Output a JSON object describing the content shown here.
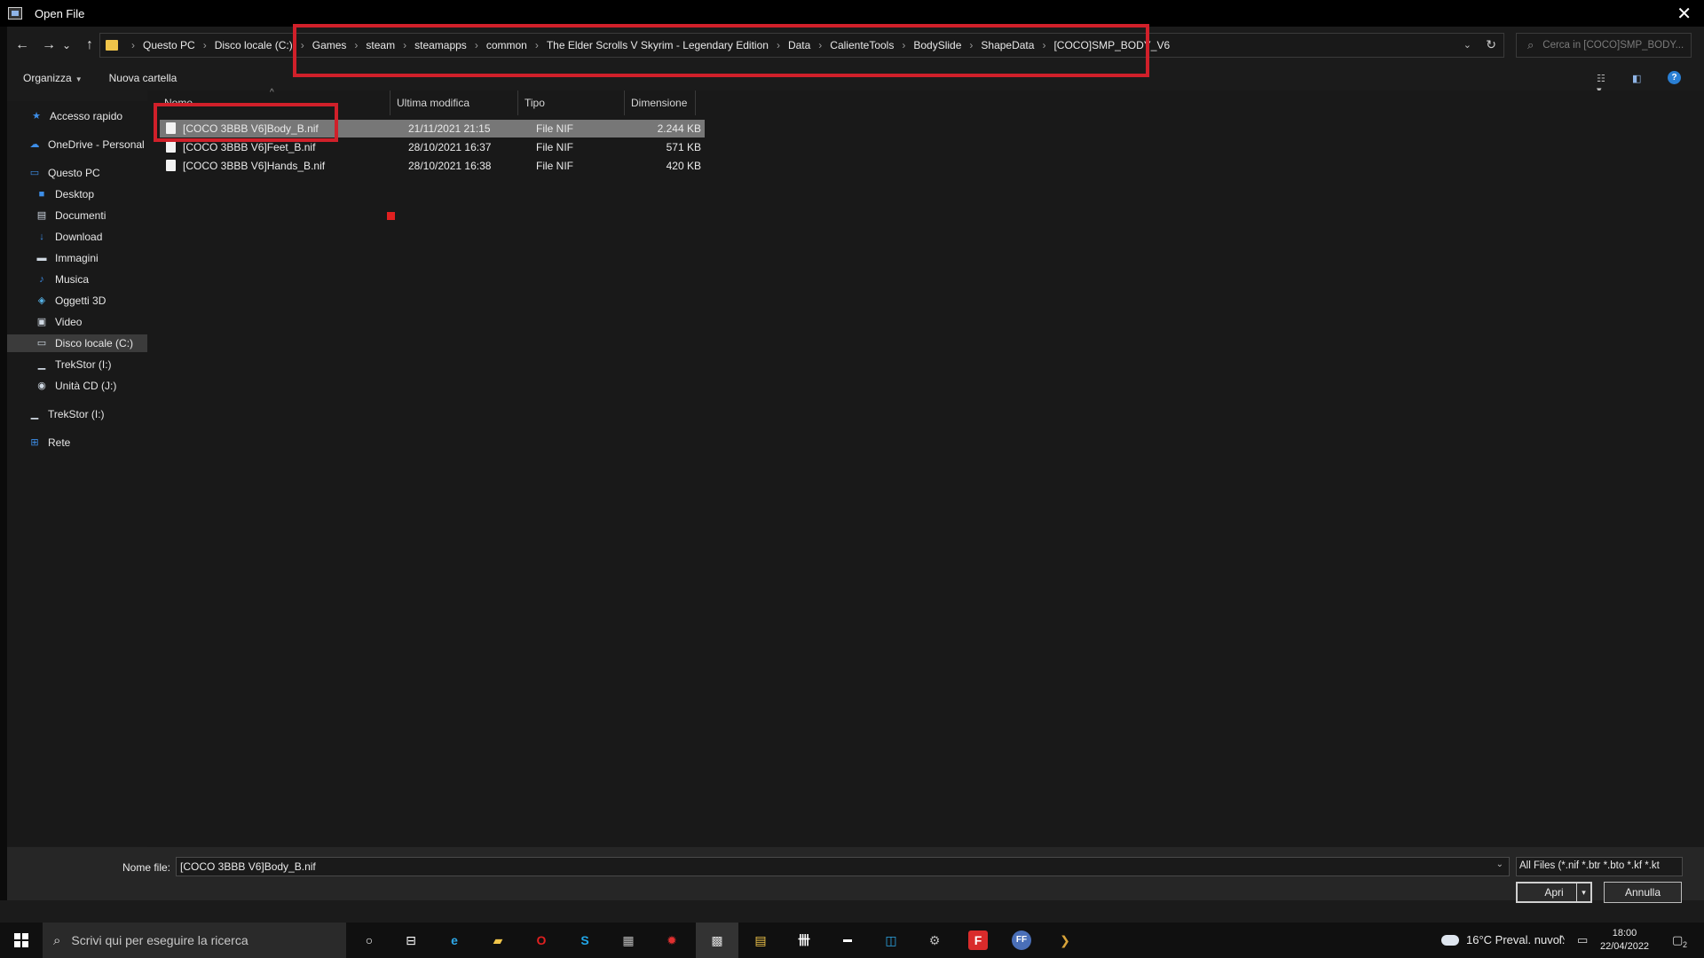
{
  "window": {
    "title": "Open File",
    "close_glyph": "✕"
  },
  "nav_buttons": {
    "back": "←",
    "forward": "→",
    "recent": "⌄",
    "up": "↑"
  },
  "address": {
    "crumbs": [
      "Questo PC",
      "Disco locale (C:)",
      "Games",
      "steam",
      "steamapps",
      "common",
      "The Elder Scrolls V Skyrim - Legendary Edition",
      "Data",
      "CalienteTools",
      "BodySlide",
      "ShapeData",
      "[COCO]SMP_BODY_V6"
    ],
    "separator": "›",
    "dropdown_glyph": "⌄",
    "refresh_glyph": "↻"
  },
  "search": {
    "placeholder": "Cerca in [COCO]SMP_BODY..."
  },
  "toolbar": {
    "organize": "Organizza",
    "new_folder": "Nuova cartella"
  },
  "sidebar": {
    "items": [
      {
        "label": "Accesso rapido",
        "icon": "star-icon"
      },
      {
        "label": "OneDrive - Personal",
        "icon": "cloud-icon"
      },
      {
        "label": "Questo PC",
        "icon": "computer-icon"
      },
      {
        "label": "Desktop",
        "icon": "desktop-icon"
      },
      {
        "label": "Documenti",
        "icon": "documents-icon"
      },
      {
        "label": "Download",
        "icon": "download-icon"
      },
      {
        "label": "Immagini",
        "icon": "images-icon"
      },
      {
        "label": "Musica",
        "icon": "music-icon"
      },
      {
        "label": "Oggetti 3D",
        "icon": "cube-icon"
      },
      {
        "label": "Video",
        "icon": "video-icon"
      },
      {
        "label": "Disco locale (C:)",
        "icon": "drive-icon"
      },
      {
        "label": "TrekStor (I:)",
        "icon": "usb-drive-icon"
      },
      {
        "label": "Unità CD (J:)",
        "icon": "cd-drive-icon"
      },
      {
        "label": "TrekStor (I:)",
        "icon": "usb-drive-icon"
      },
      {
        "label": "Rete",
        "icon": "network-icon"
      }
    ]
  },
  "columns": {
    "name": "Nome",
    "modified": "Ultima modifica",
    "type": "Tipo",
    "size": "Dimensione"
  },
  "files": [
    {
      "name": "[COCO 3BBB V6]Body_B.nif",
      "modified": "21/11/2021 21:15",
      "type": "File NIF",
      "size": "2.244 KB",
      "selected": true
    },
    {
      "name": "[COCO 3BBB V6]Feet_B.nif",
      "modified": "28/10/2021 16:37",
      "type": "File NIF",
      "size": "571 KB",
      "selected": false
    },
    {
      "name": "[COCO 3BBB V6]Hands_B.nif",
      "modified": "28/10/2021 16:38",
      "type": "File NIF",
      "size": "420 KB",
      "selected": false
    }
  ],
  "footer": {
    "filename_label": "Nome file:",
    "filename_value": "[COCO 3BBB V6]Body_B.nif",
    "filetype_value": "All Files (*.nif *.btr *.bto *.kf *.kt",
    "open_label": "Apri",
    "cancel_label": "Annulla"
  },
  "taskbar": {
    "search_placeholder": "Scrivi qui per eseguire la ricerca",
    "weather": "16°C  Preval. nuvol.",
    "time": "18:00",
    "date": "22/04/2022",
    "notification_count": "2"
  },
  "colors": {
    "annotation_red": "#d0202a",
    "selected_row": "#777777",
    "background": "#191919"
  }
}
